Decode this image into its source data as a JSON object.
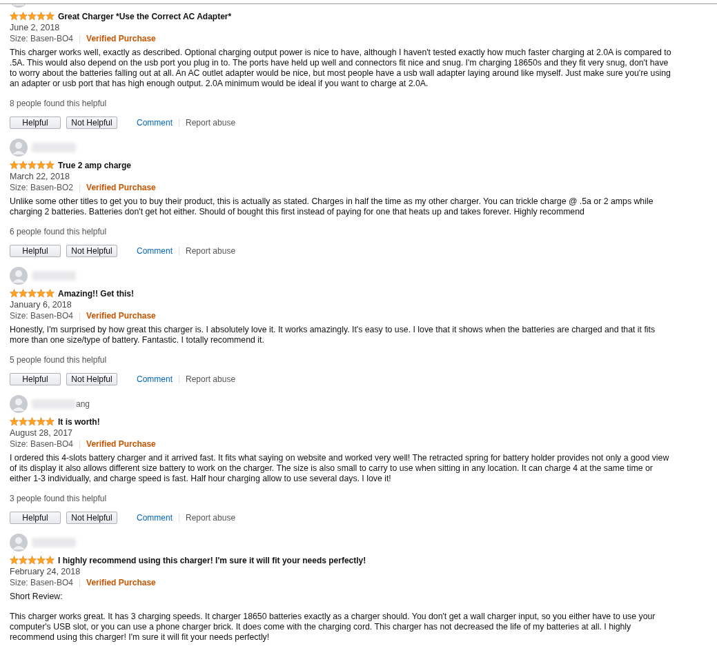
{
  "reviews": [
    {
      "stars": 5,
      "title": "Great Charger *Use the Correct AC Adapter*",
      "date": "June 2, 2018",
      "size": "Size: Basen-BO4",
      "verified": "Verified Purchase",
      "body": [
        "This charger works well, exactly as described. Optional charging output power is nice to have, although I haven't tested exactly how much faster charging at 2.0A is compared to .5A. This would also depend on the usb port you plug in to. The ports have held up well and connectors fit nice and snug. I'm charging 18650s and they fit very snug, don't have to worry about the batteries falling out at all. An AC outlet adapter would be nice, but most people have a usb wall adapter laying around like myself. Just make sure you're using an adapter or usb port that has high enough output. 2.0A minimum would be ideal if you want to charge at 2.0A."
      ],
      "helpful_count": "8 people found this helpful",
      "actions": [
        "Helpful",
        "Not Helpful",
        "Comment",
        "Report abuse"
      ]
    },
    {
      "stars": 5,
      "title": "True 2 amp charge",
      "date": "March 22, 2018",
      "size": "Size: Basen-BO2",
      "verified": "Verified Purchase",
      "body": [
        "Unlike some other titles to get you to buy their product, this is actually as stated. Charges in half the time as my other charger. You can trickle charge @ .5a or 2 amps while charging 2 batteries. Batteries don't get hot either. Should of bought this first instead of paying for one that heats up and takes forever. Highly recommend"
      ],
      "helpful_count": "6 people found this helpful",
      "actions": [
        "Helpful",
        "Not Helpful",
        "Comment",
        "Report abuse"
      ]
    },
    {
      "stars": 5,
      "title": "Amazing!! Get this!",
      "date": "January 6, 2018",
      "size": "Size: Basen-BO4",
      "verified": "Verified Purchase",
      "body": [
        "Honestly, I'm surprised by how great this charger is. I absolutely love it. It works amazingly. It's easy to use. I love that it shows when the batteries are charged and that it fits more than one size/type of battery. Fantastic. I totally recommend it."
      ],
      "helpful_count": "5 people found this helpful",
      "actions": [
        "Helpful",
        "Not Helpful",
        "Comment",
        "Report abuse"
      ]
    },
    {
      "name": "ang",
      "stars": 5,
      "title": "It is worth!",
      "date": "August 28, 2017",
      "size": "Size: Basen-BO4",
      "verified": "Verified Purchase",
      "body": [
        "I ordered this 4-slots battery charger and it arrived fast. It fits what saying on website and worked very well! The retracted spring for battery holder provides not only a good view of its display it also allows different size battery to work on the charger. The size is also small to carry to use when sitting in any location. It can charge 4 at the same time or either 1-3 individually, and charge speed is fast. Half hour charging allow to use several days. I love it!"
      ],
      "helpful_count": "3 people found this helpful",
      "actions": [
        "Helpful",
        "Not Helpful",
        "Comment",
        "Report abuse"
      ]
    },
    {
      "stars": 5,
      "title": "I highly recommend using this charger! I'm sure it will fit your needs perfectly!",
      "date": "February 24, 2018",
      "size": "Size: Basen-BO4",
      "verified": "Verified Purchase",
      "body": [
        "Short Review:",
        "This charger works great. It has 3 charging speeds. It charger 18650 batteries exactly as a charger should. You don't get a wall charger input, so you either have to use your computer's USB slot, or you can use a phone charger brick. It does come with the charging cord. This charger has not decreased the life of my batteries at all. I highly recommend using this charger! I'm sure it will fit your needs perfectly!"
      ]
    }
  ]
}
